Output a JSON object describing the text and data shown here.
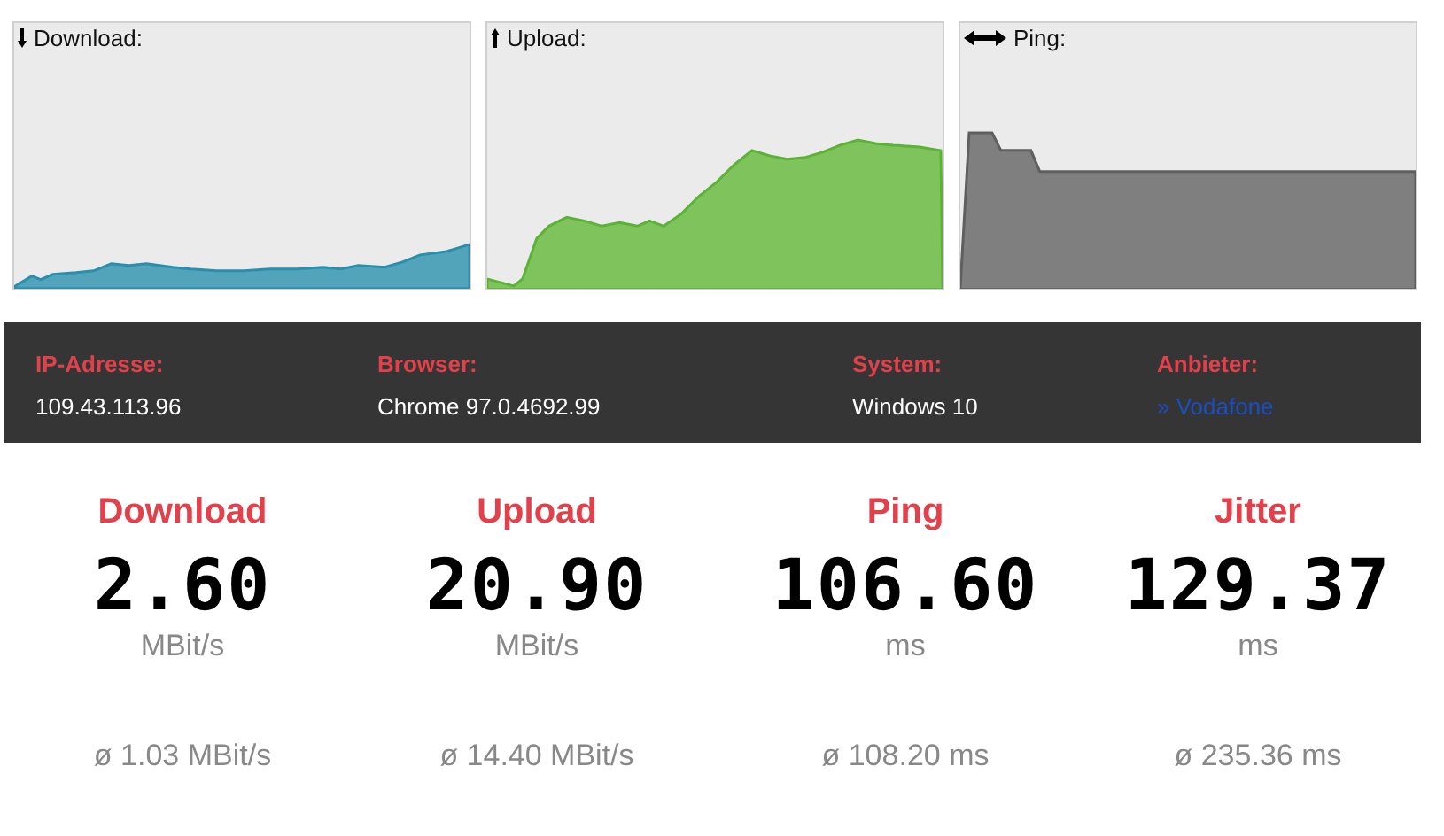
{
  "graphs": [
    {
      "kind": "download",
      "label": "Download:"
    },
    {
      "kind": "upload",
      "label": "Upload:"
    },
    {
      "kind": "ping",
      "label": "Ping:"
    }
  ],
  "info": [
    {
      "label": "IP-Adresse:",
      "value": "109.43.113.96",
      "kind": "text"
    },
    {
      "label": "Browser:",
      "value": "Chrome 97.0.4692.99",
      "kind": "text"
    },
    {
      "label": "System:",
      "value": "Windows 10",
      "kind": "text"
    },
    {
      "label": "Anbieter:",
      "value": "» Vodafone",
      "kind": "link"
    }
  ],
  "metrics": [
    {
      "title": "Download",
      "value": "2.60",
      "unit": "MBit/s",
      "average": "ø 1.03 MBit/s"
    },
    {
      "title": "Upload",
      "value": "20.90",
      "unit": "MBit/s",
      "average": "ø 14.40 MBit/s"
    },
    {
      "title": "Ping",
      "value": "106.60",
      "unit": "ms",
      "average": "ø 108.20 ms"
    },
    {
      "title": "Jitter",
      "value": "129.37",
      "unit": "ms",
      "average": "ø 235.36 ms"
    }
  ]
}
